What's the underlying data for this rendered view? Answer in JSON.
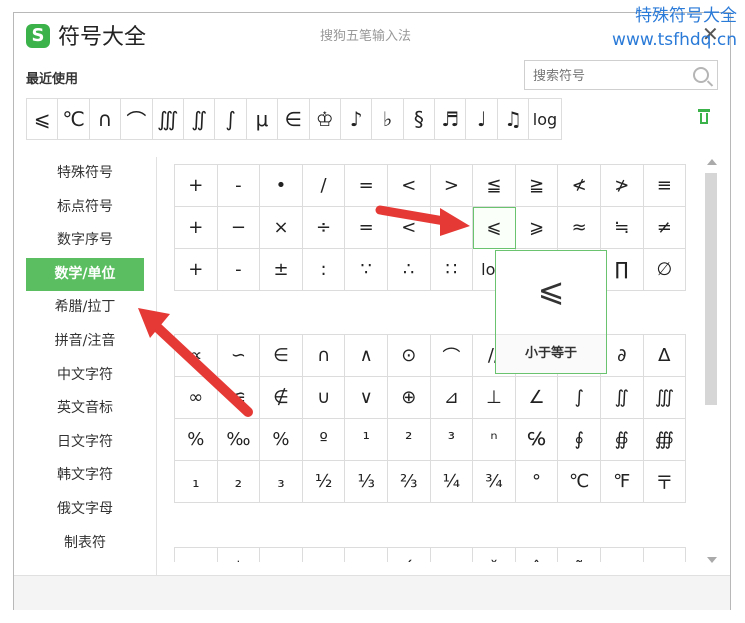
{
  "window": {
    "title": "符号大全",
    "ime_name": "搜狗五笔输入法",
    "logo_letter": "S",
    "close_glyph": "✕"
  },
  "watermark": {
    "line1": "特殊符号大全",
    "line2": "www.tsfhdq.cn"
  },
  "recent": {
    "heading": "最近使用",
    "symbols": [
      "⩽",
      "℃",
      "∩",
      "⌒",
      "∭",
      "∬",
      "∫",
      "μ",
      "∈",
      "♔",
      "♪",
      "♭",
      "§",
      "♬",
      "♩",
      "♫",
      "log"
    ]
  },
  "search": {
    "placeholder": "搜索符号"
  },
  "sidebar": {
    "items": [
      "特殊符号",
      "标点符号",
      "数字序号",
      "数学/单位",
      "希腊/拉丁",
      "拼音/注音",
      "中文字符",
      "英文音标",
      "日文字符",
      "韩文字符",
      "俄文字母",
      "制表符"
    ],
    "active_index": 3
  },
  "grid1": [
    "+",
    "-",
    "•",
    "/",
    "=",
    "<",
    ">",
    "≦",
    "≧",
    "≮",
    "≯",
    "≡",
    "+",
    "−",
    "×",
    "÷",
    "=",
    "<",
    ">",
    "⩽",
    "⩾",
    "≈",
    "≒",
    "≠",
    "+",
    "-",
    "±",
    ":",
    "∵",
    "∴",
    "∷",
    "lo",
    "",
    "",
    "∏",
    "∅"
  ],
  "grid2": [
    "∝",
    "∽",
    "∈",
    "∩",
    "∧",
    "⊙",
    "⌒",
    "//",
    "",
    "",
    "∂",
    "∆",
    "∞",
    "≌",
    "∉",
    "∪",
    "∨",
    "⊕",
    "⊿",
    "⊥",
    "∠",
    "∫",
    "∬",
    "∭",
    "%",
    "‰",
    "%",
    "º",
    "¹",
    "²",
    "³",
    "ⁿ",
    "℅",
    "∮",
    "∯",
    "∰",
    "₁",
    "₂",
    "₃",
    "½",
    "⅓",
    "⅔",
    "¼",
    "¾",
    "°",
    "℃",
    "℉",
    "〒"
  ],
  "grid3": [
    "",
    "ˈ",
    "",
    "",
    "ˌ",
    "ˊ",
    "",
    "ˇ",
    "ˆ",
    "˜",
    "",
    ""
  ],
  "tooltip": {
    "symbol": "⩽",
    "label": "小于等于"
  },
  "colors": {
    "accent": "#5bbf61",
    "arrow": "#e53935",
    "watermark": "#2a7ad8"
  }
}
